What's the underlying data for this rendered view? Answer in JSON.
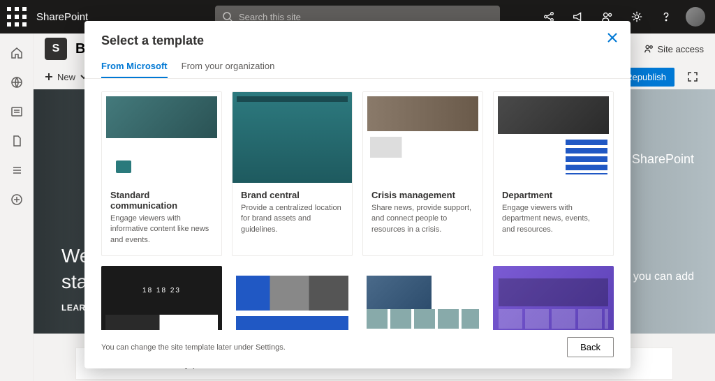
{
  "topbar": {
    "app_name": "SharePoint",
    "search_placeholder": "Search this site"
  },
  "siteheader": {
    "site_name_partial": "Bi",
    "site_access": "Site access"
  },
  "cmdbar": {
    "new_label": "New",
    "republish_label": "Republish"
  },
  "hero": {
    "title_line_prefix": "Welcom",
    "title_line2_prefix": "start cu",
    "learn_more": "LEARN MOR",
    "right1_suffix": "the SharePoint",
    "right2_suffix": "rts you can add"
  },
  "faq": {
    "q1": "How do I reset my password?"
  },
  "modal": {
    "title": "Select a template",
    "tabs": {
      "microsoft": "From Microsoft",
      "org": "From your organization"
    },
    "footer_note": "You can change the site template later under Settings.",
    "back_label": "Back",
    "templates": [
      {
        "name": "Standard communication",
        "desc": "Engage viewers with informative content like news and events."
      },
      {
        "name": "Brand central",
        "desc": "Provide a centralized location for brand assets and guidelines."
      },
      {
        "name": "Crisis management",
        "desc": "Share news, provide support, and connect people to resources in a crisis."
      },
      {
        "name": "Department",
        "desc": "Engage viewers with department news, events, and resources."
      }
    ]
  }
}
